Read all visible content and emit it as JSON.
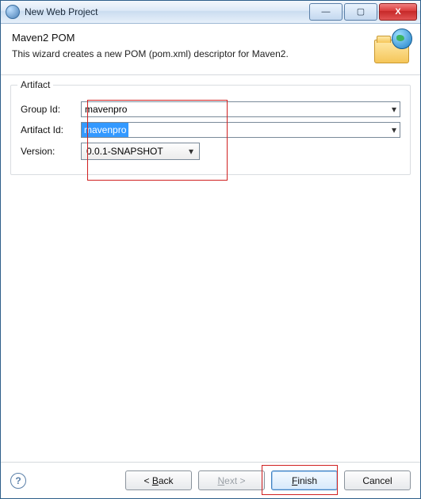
{
  "window": {
    "title": "New Web Project",
    "controls": {
      "min": "—",
      "max": "▢",
      "close": "X"
    }
  },
  "header": {
    "title": "Maven2 POM",
    "description": "This wizard creates a new POM (pom.xml) descriptor for Maven2."
  },
  "artifact": {
    "group_title": "Artifact",
    "group_id_label": "Group Id:",
    "group_id_value": "mavenpro",
    "artifact_id_label": "Artifact Id:",
    "artifact_id_value": "mavenpro",
    "version_label": "Version:",
    "version_value": "0.0.1-SNAPSHOT"
  },
  "buttons": {
    "back": "< Back",
    "next": "Next >",
    "finish": "Finish",
    "cancel": "Cancel"
  },
  "help_glyph": "?",
  "dropdown_glyph": "▾"
}
